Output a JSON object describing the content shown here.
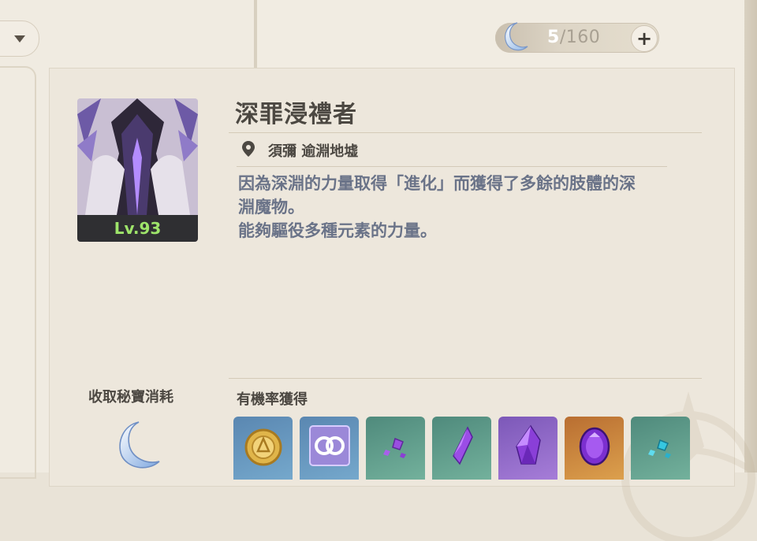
{
  "header": {
    "resin_current": "5",
    "resin_total": "/160",
    "plus_label": "+"
  },
  "enemy": {
    "name": "深罪浸禮者",
    "level": "Lv.93",
    "location": "須彌 逾淵地墟",
    "description_lines": [
      "因為深淵的力量取得「進化」而獲得了多餘的肢體的深",
      "淵魔物。",
      "能夠驅役多種元素的力量。"
    ]
  },
  "cost": {
    "label": "收取秘寶消耗",
    "icon": "moon-resin-icon"
  },
  "drops": {
    "label": "有機率獲得",
    "items": [
      {
        "icon": "mora-coin-icon",
        "rarity_color": "#6a9bc4"
      },
      {
        "icon": "companionship-exp-icon",
        "rarity_color": "#6a9bc4"
      },
      {
        "icon": "amethyst-sliver-icon",
        "rarity_color": "#5fa08a"
      },
      {
        "icon": "amethyst-fragment-icon",
        "rarity_color": "#5fa08a"
      },
      {
        "icon": "amethyst-chunk-icon",
        "rarity_color": "#9470cc"
      },
      {
        "icon": "amethyst-gemstone-icon",
        "rarity_color": "#cc8a40"
      },
      {
        "icon": "turquoise-sliver-icon",
        "rarity_color": "#5fa08a"
      }
    ]
  },
  "colors": {
    "title_text": "#4c4842",
    "description_text": "#6a7388",
    "level_text": "#9ee46a"
  }
}
